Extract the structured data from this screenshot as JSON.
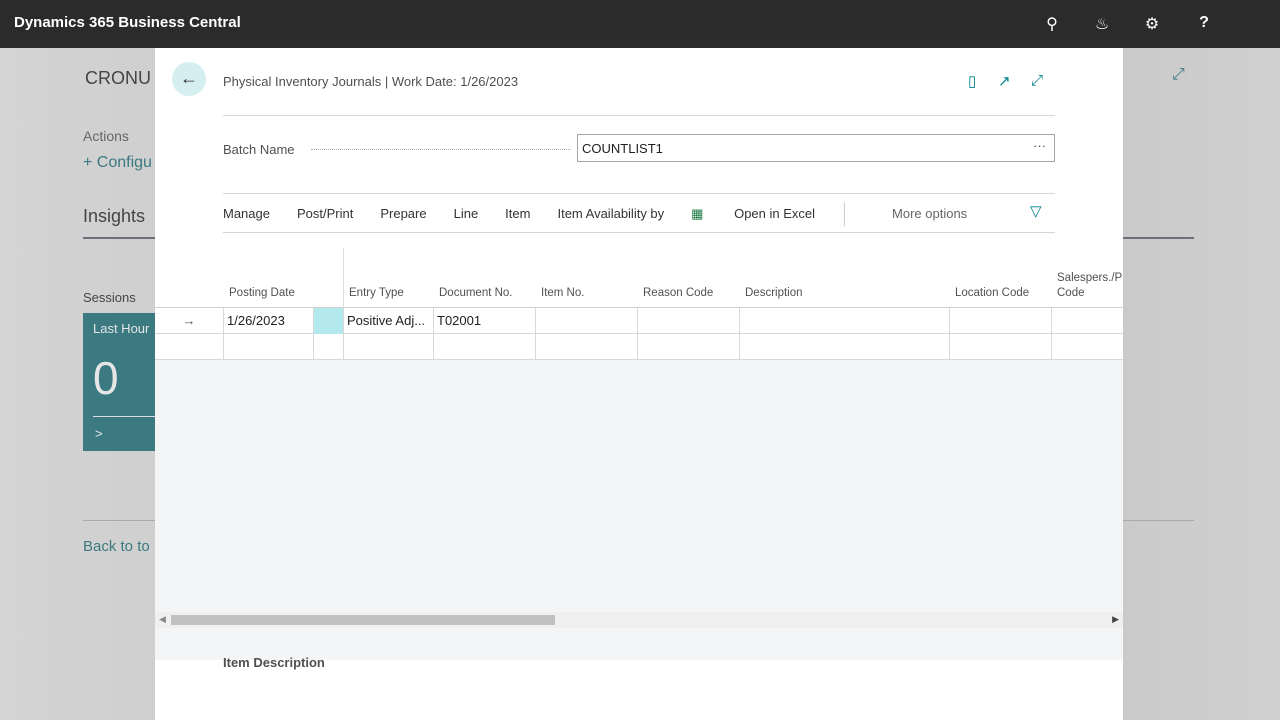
{
  "app": {
    "title": "Dynamics 365 Business Central",
    "icons": [
      "search-icon",
      "bell-icon",
      "gear-icon",
      "help-icon"
    ]
  },
  "background": {
    "company": "CRONU",
    "actions_label": "Actions",
    "configure": "+ Configu",
    "insights": "Insights",
    "sessions": "Sessions",
    "tile_label": "Last Hour",
    "tile_value": "0",
    "tile_chevron": ">",
    "back_link": "Back to to"
  },
  "dialog": {
    "breadcrumb": "Physical Inventory Journals | Work Date: 1/26/2023",
    "batch_label": "Batch Name",
    "batch_value": "COUNTLIST1",
    "batch_more": "···",
    "menu": [
      "Manage",
      "Post/Print",
      "Prepare",
      "Line",
      "Item",
      "Item Availability by"
    ],
    "open_excel": "Open in Excel",
    "more_options": "More options",
    "columns": [
      "Posting Date",
      "Entry Type",
      "Document No.",
      "Item No.",
      "Reason Code",
      "Description",
      "Location Code",
      "Salespers./Pu Code"
    ],
    "rows": [
      {
        "arrow": "→",
        "posting_date": "1/26/2023",
        "entry_type": "Positive Adj...",
        "document_no": "T02001"
      }
    ],
    "item_description": "Item Description",
    "accent": "#00828a",
    "selected_cell": "#b3e8ec"
  }
}
